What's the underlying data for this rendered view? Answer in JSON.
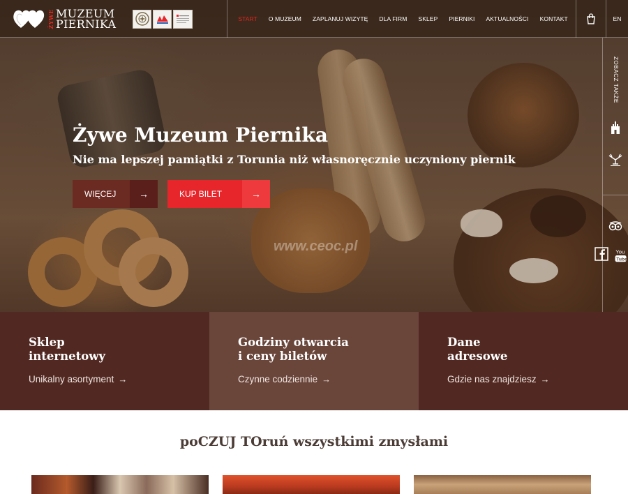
{
  "header": {
    "logo": {
      "top": "ŻYWE",
      "line1": "MUZEUM",
      "line2": "PIERNIKA"
    },
    "partners": [
      "partner-logo-1",
      "partner-logo-2",
      "partner-logo-3"
    ],
    "nav": [
      "START",
      "O MUZEUM",
      "ZAPLANUJ WIZYTĘ",
      "DLA FIRM",
      "SKLEP",
      "PIERNIKI",
      "AKTUALNOŚCI",
      "KONTAKT"
    ],
    "active_nav": "START",
    "cart_icon": "shopping-bag-icon",
    "lang": "EN"
  },
  "side": {
    "label": "ZOBACZ TAKŻE",
    "icons": [
      "castle-icon",
      "museum-emblem-icon",
      "tripadvisor-icon",
      "facebook-icon",
      "youtube-icon"
    ]
  },
  "hero": {
    "title": "Żywe Muzeum Piernika",
    "subtitle": "Nie ma lepszej pamiątki z Torunia niż własnoręcznie uczyniony piernik",
    "btn_more": "WIĘCEJ",
    "btn_ticket": "KUP BILET",
    "arrow": "→",
    "watermark": "www.ceoc.pl"
  },
  "tiles": [
    {
      "title1": "Sklep",
      "title2": "internetowy",
      "link": "Unikalny asortyment"
    },
    {
      "title1": "Godziny otwarcia",
      "title2": "i ceny biletów",
      "link": "Czynne codziennie"
    },
    {
      "title1": "Dane",
      "title2": "adresowe",
      "link": "Gdzie nas znajdziesz"
    }
  ],
  "section": {
    "title": "poCZUJ TOruń wszystkimi zmysłami"
  },
  "colors": {
    "accent_red": "#e6262b",
    "brown_dark": "#522922",
    "brown_mid": "#6a453a",
    "btn_dark": "#6b2a22"
  }
}
